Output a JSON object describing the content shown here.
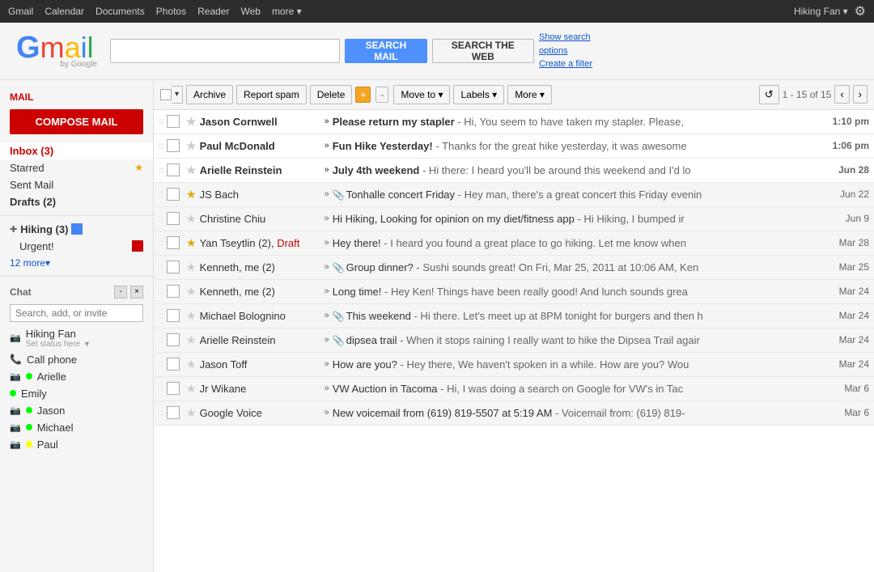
{
  "topbar": {
    "items": [
      "Gmail",
      "Calendar",
      "Documents",
      "Photos",
      "Reader",
      "Web",
      "more ▾"
    ],
    "user": "Hiking Fan ▾",
    "gear": "⚙"
  },
  "header": {
    "logo": {
      "g": "G",
      "m": "m",
      "a": "a",
      "i": "i",
      "l": "l",
      "by": "by Google"
    },
    "search_placeholder": "",
    "search_mail_label": "SEARCH MAIL",
    "search_web_label": "SEARCH THE WEB",
    "show_options": "Show search options",
    "create_filter": "Create a filter"
  },
  "sidebar": {
    "mail_label": "Mail",
    "compose_label": "COMPOSE MAIL",
    "inbox_label": "Inbox (3)",
    "starred_label": "Starred",
    "sent_label": "Sent Mail",
    "drafts_label": "Drafts (2)",
    "hiking_label": "Hiking (3)",
    "urgent_label": "Urgent!",
    "more_label": "12 more▾",
    "chat_label": "Chat",
    "chat_search_placeholder": "Search, add, or invite",
    "chat_user1_name": "Hiking Fan",
    "chat_user1_status": "Set status here",
    "call_phone_label": "Call phone",
    "chat_user3_name": "Arielle",
    "chat_user4_name": "Emily",
    "chat_user5_name": "Jason",
    "chat_user6_name": "Michael",
    "chat_user7_name": "Paul"
  },
  "toolbar": {
    "archive_label": "Archive",
    "spam_label": "Report spam",
    "delete_label": "Delete",
    "moveto_label": "Move to ▾",
    "labels_label": "Labels ▾",
    "more_label": "More ▾",
    "page_info": "1 - 15 of 15",
    "refresh_icon": "↺",
    "prev_icon": "‹",
    "next_icon": "›"
  },
  "emails": [
    {
      "sender": "Jason Cornwell",
      "subject": "Please return my stapler",
      "preview": "Hi, You seem to have taken my stapler. Please,",
      "date": "1:10 pm",
      "unread": true,
      "starred": false,
      "draft": false,
      "attach": false,
      "arrow": "»"
    },
    {
      "sender": "Paul McDonald",
      "subject": "Fun Hike Yesterday!",
      "preview": "Thanks for the great hike yesterday, it was awesome",
      "date": "1:06 pm",
      "unread": true,
      "starred": false,
      "draft": false,
      "attach": false,
      "arrow": "»"
    },
    {
      "sender": "Arielle Reinstein",
      "subject": "July 4th weekend",
      "preview": "Hi there: I heard you'll be around this weekend and I'd lo",
      "date": "Jun 28",
      "unread": true,
      "starred": false,
      "draft": false,
      "attach": false,
      "arrow": "»"
    },
    {
      "sender": "JS Bach",
      "subject": "Tonhalle concert Friday",
      "preview": "Hey man, there's a great concert this Friday evenin",
      "date": "Jun 22",
      "unread": false,
      "starred": true,
      "draft": false,
      "attach": true,
      "arrow": "»"
    },
    {
      "sender": "Christine Chiu",
      "subject": "Hi Hiking, Looking for opinion on my diet/fitness app",
      "preview": "Hi Hiking, I bumped ir",
      "date": "Jun 9",
      "unread": false,
      "starred": false,
      "draft": false,
      "attach": false,
      "arrow": "»"
    },
    {
      "sender": "Yan Tseytlin (2), Draft",
      "sender_main": "Yan Tseytlin (2),",
      "sender_draft": " Draft",
      "subject": "Hey there!",
      "preview": "I heard you found a great place to go hiking. Let me know when",
      "date": "Mar 28",
      "unread": false,
      "starred": true,
      "draft": true,
      "attach": false,
      "arrow": "»"
    },
    {
      "sender": "Kenneth, me (2)",
      "subject": "Group dinner?",
      "preview": "Sushi sounds great! On Fri, Mar 25, 2011 at 10:06 AM, Ken",
      "date": "Mar 25",
      "unread": false,
      "starred": false,
      "draft": false,
      "attach": true,
      "arrow": "»"
    },
    {
      "sender": "Kenneth, me (2)",
      "subject": "Long time!",
      "preview": "Hey Ken! Things have been really good! And lunch sounds grea",
      "date": "Mar 24",
      "unread": false,
      "starred": false,
      "draft": false,
      "attach": false,
      "arrow": "»"
    },
    {
      "sender": "Michael Bolognino",
      "subject": "This weekend",
      "preview": "Hi there. Let's meet up at 8PM tonight for burgers and then h",
      "date": "Mar 24",
      "unread": false,
      "starred": false,
      "draft": false,
      "attach": true,
      "arrow": "»"
    },
    {
      "sender": "Arielle Reinstein",
      "subject": "dipsea trail",
      "preview": "When it stops raining I really want to hike the Dipsea Trail agair",
      "date": "Mar 24",
      "unread": false,
      "starred": false,
      "draft": false,
      "attach": true,
      "arrow": "»"
    },
    {
      "sender": "Jason Toff",
      "subject": "How are you?",
      "preview": "Hey there, We haven't spoken in a while. How are you? Wou",
      "date": "Mar 24",
      "unread": false,
      "starred": false,
      "draft": false,
      "attach": false,
      "arrow": "»"
    },
    {
      "sender": "Jr Wikane",
      "subject": "VW Auction in Tacoma",
      "preview": "Hi, I was doing a search on Google for VW's in Tac",
      "date": "Mar 6",
      "unread": false,
      "starred": false,
      "draft": false,
      "attach": false,
      "arrow": "»"
    },
    {
      "sender": "Google Voice",
      "subject": "New voicemail from (619) 819-5507 at 5:19 AM",
      "preview": "Voicemail from: (619) 819-",
      "date": "Mar 6",
      "unread": false,
      "starred": false,
      "draft": false,
      "attach": false,
      "arrow": "»"
    }
  ]
}
